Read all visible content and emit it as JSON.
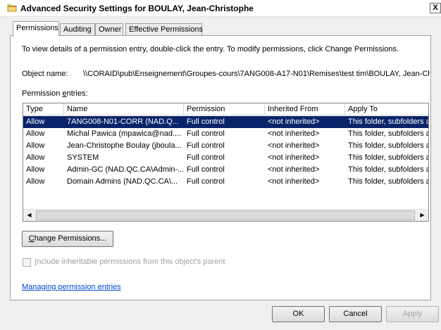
{
  "window": {
    "title": "Advanced Security Settings for BOULAY, Jean-Christophe",
    "close_glyph": "X"
  },
  "tabs": [
    {
      "label": "Permissions",
      "active": true
    },
    {
      "label": "Auditing",
      "active": false
    },
    {
      "label": "Owner",
      "active": false
    },
    {
      "label": "Effective Permissions",
      "active": false
    }
  ],
  "panel": {
    "instructions": "To view details of a permission entry, double-click the entry. To modify permissions, click Change Permissions.",
    "object_name_label": "Object name:",
    "object_name_value": "\\\\CORAID\\pub\\Enseignement\\Groupes-cours\\7ANG008-A17-N01\\Remises\\test tim\\BOULAY, Jean-Christophe",
    "entries_label_before": "Permission ",
    "entries_label_underlined": "e",
    "entries_label_after": "ntries:"
  },
  "table": {
    "columns": [
      "Type",
      "Name",
      "Permission",
      "Inherited From",
      "Apply To"
    ],
    "rows": [
      {
        "type": "Allow",
        "name": "7ANG008-N01-CORR (NAD.Q...",
        "permission": "Full control",
        "inherited": "<not inherited>",
        "apply": "This folder, subfolders and files",
        "selected": true
      },
      {
        "type": "Allow",
        "name": "Michal Pawica (mpawica@nad....",
        "permission": "Full control",
        "inherited": "<not inherited>",
        "apply": "This folder, subfolders and files",
        "selected": false
      },
      {
        "type": "Allow",
        "name": "Jean-Christophe Boulay (jboula...",
        "permission": "Full control",
        "inherited": "<not inherited>",
        "apply": "This folder, subfolders and files",
        "selected": false
      },
      {
        "type": "Allow",
        "name": "SYSTEM",
        "permission": "Full control",
        "inherited": "<not inherited>",
        "apply": "This folder, subfolders and files",
        "selected": false
      },
      {
        "type": "Allow",
        "name": "Admin-GC (NAD.QC.CA\\Admin-...",
        "permission": "Full control",
        "inherited": "<not inherited>",
        "apply": "This folder, subfolders and files",
        "selected": false
      },
      {
        "type": "Allow",
        "name": "Domain Admins (NAD.QC.CA\\...",
        "permission": "Full control",
        "inherited": "<not inherited>",
        "apply": "This folder, subfolders and files",
        "selected": false
      }
    ],
    "scroll_left_glyph": "◀",
    "scroll_right_glyph": "▶"
  },
  "buttons": {
    "change_permissions_underlined": "C",
    "change_permissions_rest": "hange Permissions...",
    "ok": "OK",
    "cancel": "Cancel",
    "apply": "Apply"
  },
  "options": {
    "include_inheritable_underlined": "I",
    "include_inheritable_rest": "nclude inheritable permissions from this object's parent",
    "include_inheritable_checked": false
  },
  "links": {
    "managing": "Managing permission entries"
  },
  "colors": {
    "selection": "#0a246a",
    "link": "#0046d5",
    "disabled_text": "#a0a0a0"
  }
}
